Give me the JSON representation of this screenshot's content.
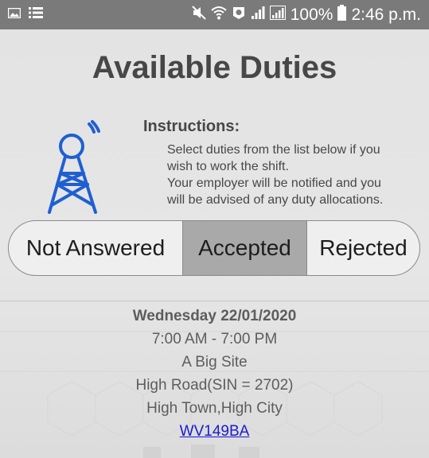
{
  "status_bar": {
    "left_icons": [
      "image-icon",
      "list-icon"
    ],
    "right_icons": [
      "mute-icon",
      "wifi-icon",
      "sync-icon",
      "signal-icon",
      "signal-icon-2",
      "battery-icon"
    ],
    "battery": "100%",
    "time": "2:46 p.m."
  },
  "page": {
    "title": "Available Duties"
  },
  "instructions": {
    "title": "Instructions:",
    "lines": [
      "Select duties from the list below if you",
      "wish to work the shift.",
      "Your employer will be notified and you",
      "will be advised of any duty allocations."
    ]
  },
  "tabs": [
    {
      "label": "Not Answered",
      "selected": false
    },
    {
      "label": "Accepted",
      "selected": true
    },
    {
      "label": "Rejected",
      "selected": false
    }
  ],
  "duty": {
    "day": "Wednesday 22/01/2020",
    "time": "7:00 AM - 7:00 PM",
    "site": "A Big Site",
    "address": "High Road(SIN = 2702)",
    "town": "High Town,High City",
    "reference": "WV149BA"
  },
  "colors": {
    "status_bar": "#7a7a7a",
    "tower_blue": "#1f5fd1",
    "selected_tab": "#a9a9a9",
    "link": "#1a1ad6"
  }
}
